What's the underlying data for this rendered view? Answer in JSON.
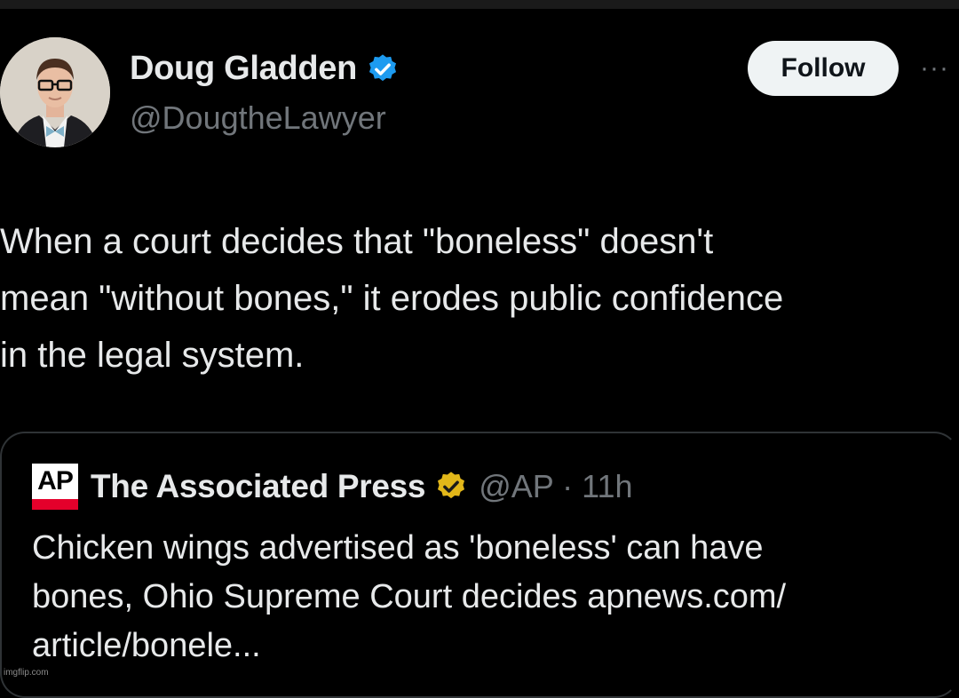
{
  "author": {
    "display_name": "Doug Gladden",
    "handle": "@DougtheLawyer",
    "verified_icon": "verified-badge-icon",
    "badge_color": "#1d9bf0"
  },
  "actions": {
    "follow_label": "Follow",
    "more_label": "···"
  },
  "tweet": {
    "text": "When a court decides that \"boneless\" doesn't\nmean \"without bones,\" it erodes public confidence\nin the legal system."
  },
  "quoted_tweet": {
    "logo_text": "AP",
    "display_name": "The Associated Press",
    "meta": "@AP · 11h",
    "badge_color": "#e2b719",
    "text": "Chicken wings advertised as 'boneless' can have\nbones, Ohio Supreme Court decides apnews.com/\narticle/bonele..."
  },
  "watermark": "imgflip.com"
}
